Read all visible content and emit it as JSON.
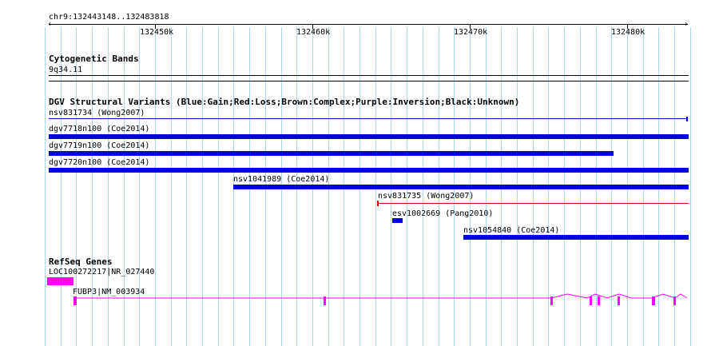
{
  "ruler": {
    "region": "chr9:132443148..132483818",
    "ticks": [
      "132450k",
      "132460k",
      "132470k",
      "132480k"
    ]
  },
  "tracks": {
    "cytoband": {
      "title": "Cytogenetic Bands",
      "band": "9q34.11"
    },
    "dgv": {
      "title": "DGV Structural Variants (Blue:Gain;Red:Loss;Brown:Complex;Purple:Inversion;Black:Unknown)",
      "features": [
        {
          "label": "nsv831734 (Wong2007)",
          "color": "#0000dd",
          "style": "thin"
        },
        {
          "label": "dgv7718n100 (Coe2014)",
          "color": "#0000dd",
          "style": "thick"
        },
        {
          "label": "dgv7719n100 (Coe2014)",
          "color": "#0000dd",
          "style": "thick"
        },
        {
          "label": "dgv7720n100 (Coe2014)",
          "color": "#0000dd",
          "style": "thick"
        },
        {
          "label": "nsv1041989 (Coe2014)",
          "color": "#0000dd",
          "style": "thick"
        },
        {
          "label": "nsv831735 (Wong2007)",
          "color": "#dd0000",
          "style": "thin"
        },
        {
          "label": "esv1002669 (Pang2010)",
          "color": "#0000dd",
          "style": "thick"
        },
        {
          "label": "nsv1054840 (Coe2014)",
          "color": "#0000dd",
          "style": "thick"
        }
      ]
    },
    "refseq": {
      "title": "RefSeq Genes",
      "genes": [
        {
          "label": "LOC100272217|NR_027440",
          "color": "#ff00ff"
        },
        {
          "label": "FUBP3|NM_003934",
          "color": "#ff00ff"
        }
      ]
    }
  },
  "colors": {
    "grid": "#add8e6",
    "gain": "#0000dd",
    "loss": "#dd0000",
    "gene": "#ff00ff"
  }
}
